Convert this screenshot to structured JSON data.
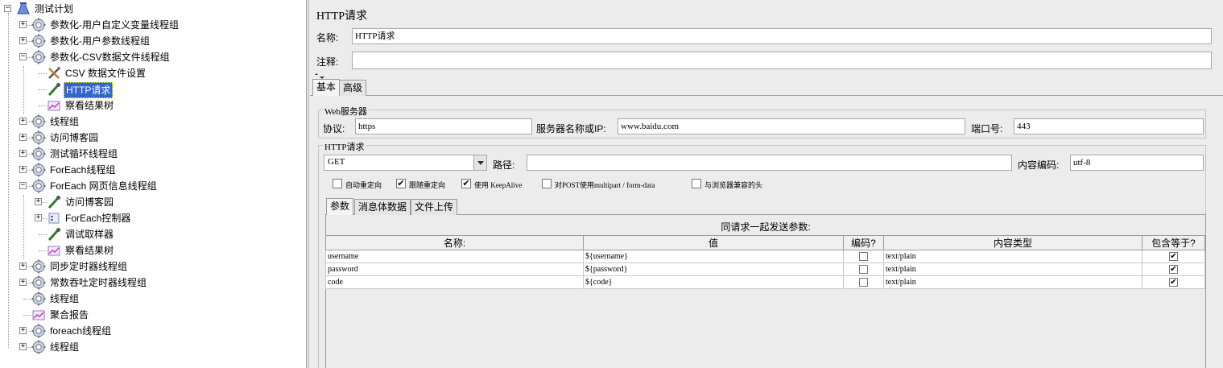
{
  "tree": {
    "items": [
      {
        "label": "测试计划",
        "icon": "test-plan-icon",
        "exp": "-",
        "level": 0
      },
      {
        "label": "参数化-用户自定义变量线程组",
        "icon": "thread-group-gear-icon",
        "exp": "+",
        "level": 1
      },
      {
        "label": "参数化-用户参数线程组",
        "icon": "thread-group-gear-icon",
        "exp": "+",
        "level": 1
      },
      {
        "label": "参数化-CSV数据文件线程组",
        "icon": "thread-group-gear-icon",
        "exp": "-",
        "level": 1
      },
      {
        "label": "CSV 数据文件设置",
        "icon": "config-tools-icon",
        "exp": "",
        "level": 2
      },
      {
        "label": "HTTP请求",
        "icon": "sampler-pipette-icon",
        "exp": "",
        "level": 2,
        "selected": true
      },
      {
        "label": "察看结果树",
        "icon": "listener-graph-icon",
        "exp": "",
        "level": 2
      },
      {
        "label": "线程组",
        "icon": "thread-group-gear-icon",
        "exp": "+",
        "level": 1
      },
      {
        "label": "访问博客园",
        "icon": "thread-group-gear-icon",
        "exp": "+",
        "level": 1
      },
      {
        "label": "测试循环线程组",
        "icon": "thread-group-gear-icon",
        "exp": "+",
        "level": 1
      },
      {
        "label": "ForEach线程组",
        "icon": "thread-group-gear-icon",
        "exp": "+",
        "level": 1
      },
      {
        "label": "ForEach 网页信息线程组",
        "icon": "thread-group-gear-icon",
        "exp": "-",
        "level": 1
      },
      {
        "label": "访问博客园",
        "icon": "sampler-pipette-icon",
        "exp": "+",
        "level": 2
      },
      {
        "label": "ForEach控制器",
        "icon": "controller-icon",
        "exp": "+",
        "level": 2
      },
      {
        "label": "调试取样器",
        "icon": "sampler-pipette-icon",
        "exp": "",
        "level": 2
      },
      {
        "label": "察看结果树",
        "icon": "listener-graph-icon",
        "exp": "",
        "level": 2
      },
      {
        "label": "同步定时器线程组",
        "icon": "thread-group-gear-icon",
        "exp": "+",
        "level": 1
      },
      {
        "label": "常数吞吐定时器线程组",
        "icon": "thread-group-gear-icon",
        "exp": "+",
        "level": 1
      },
      {
        "label": "线程组",
        "icon": "thread-group-gear-icon",
        "exp": "",
        "level": 1
      },
      {
        "label": "聚合报告",
        "icon": "listener-graph-icon",
        "exp": "",
        "level": 1
      },
      {
        "label": "foreach线程组",
        "icon": "thread-group-gear-icon",
        "exp": "+",
        "level": 1
      },
      {
        "label": "线程组",
        "icon": "thread-group-gear-icon",
        "exp": "+",
        "level": 1
      }
    ]
  },
  "panel": {
    "title": "HTTP请求",
    "name_label": "名称:",
    "name_value": "HTTP请求",
    "comment_label": "注释:",
    "comment_value": "",
    "tabs": [
      "基本",
      "高级"
    ],
    "web_server": {
      "group_title": "Web服务器",
      "protocol_label": "协议:",
      "protocol_value": "https",
      "server_label": "服务器名称或IP:",
      "server_value": "www.baidu.com",
      "port_label": "端口号:",
      "port_value": "443"
    },
    "http_request": {
      "group_title": "HTTP请求",
      "method_value": "GET",
      "path_label": "路径:",
      "path_value": "",
      "encoding_label": "内容编码:",
      "encoding_value": "utf-8"
    },
    "options": [
      {
        "label": "自动重定向",
        "checked": false
      },
      {
        "label": "跟随重定向",
        "checked": true
      },
      {
        "label": "使用 KeepAlive",
        "checked": true
      },
      {
        "label": "对POST使用multipart / form-data",
        "checked": false
      },
      {
        "label": "与浏览器兼容的头",
        "checked": false
      }
    ],
    "sub_tabs": [
      "参数",
      "消息体数据",
      "文件上传"
    ],
    "params_caption": "同请求一起发送参数:",
    "columns": [
      "名称:",
      "值",
      "编码?",
      "内容类型",
      "包含等于?"
    ],
    "rows": [
      {
        "name": "username",
        "value": "${username}",
        "encode": false,
        "content_type": "text/plain",
        "include_equals": true
      },
      {
        "name": "password",
        "value": "${password}",
        "encode": false,
        "content_type": "text/plain",
        "include_equals": true
      },
      {
        "name": "code",
        "value": "${code}",
        "encode": false,
        "content_type": "text/plain",
        "include_equals": true
      }
    ],
    "check_mark": "✔"
  }
}
